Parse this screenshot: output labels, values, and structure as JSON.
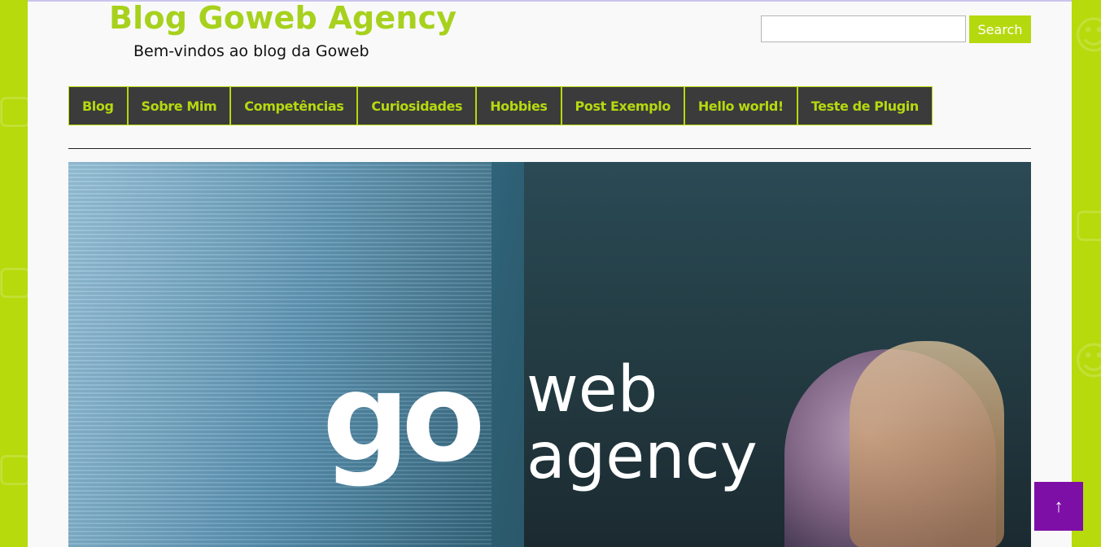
{
  "header": {
    "site_title": "Blog Goweb Agency",
    "tagline": "Bem-vindos ao blog da Goweb"
  },
  "search": {
    "value": "",
    "placeholder": "",
    "button_label": "Search"
  },
  "nav": {
    "items": [
      {
        "label": "Blog"
      },
      {
        "label": "Sobre Mim"
      },
      {
        "label": "Competências"
      },
      {
        "label": "Curiosidades"
      },
      {
        "label": "Hobbies"
      },
      {
        "label": "Post Exemplo"
      },
      {
        "label": "Hello world!"
      },
      {
        "label": "Teste de Plugin"
      }
    ]
  },
  "hero": {
    "logo_go": "go",
    "logo_web": "web",
    "logo_agency": "agency"
  },
  "back_to_top": {
    "label": "↑"
  },
  "colors": {
    "accent_green": "#b5d90f",
    "nav_background": "#3b3b3b",
    "back_to_top": "#7d0fa6"
  }
}
